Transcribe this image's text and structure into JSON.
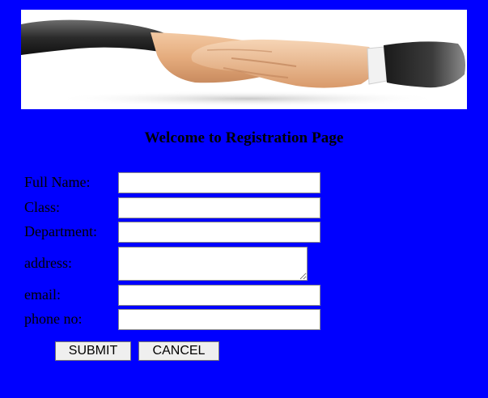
{
  "banner": {
    "icon": "handshake-image"
  },
  "heading": "Welcome to Registration Page",
  "form": {
    "fields": [
      {
        "label": "Full Name:",
        "value": ""
      },
      {
        "label": "Class:",
        "value": ""
      },
      {
        "label": "Department:",
        "value": ""
      },
      {
        "label": "address:",
        "value": ""
      },
      {
        "label": "email:",
        "value": ""
      },
      {
        "label": "phone no:",
        "value": ""
      }
    ],
    "submit_label": "SUBMIT",
    "cancel_label": "CANCEL"
  },
  "colors": {
    "page_background": "#0000ff",
    "banner_background": "#ffffff"
  }
}
